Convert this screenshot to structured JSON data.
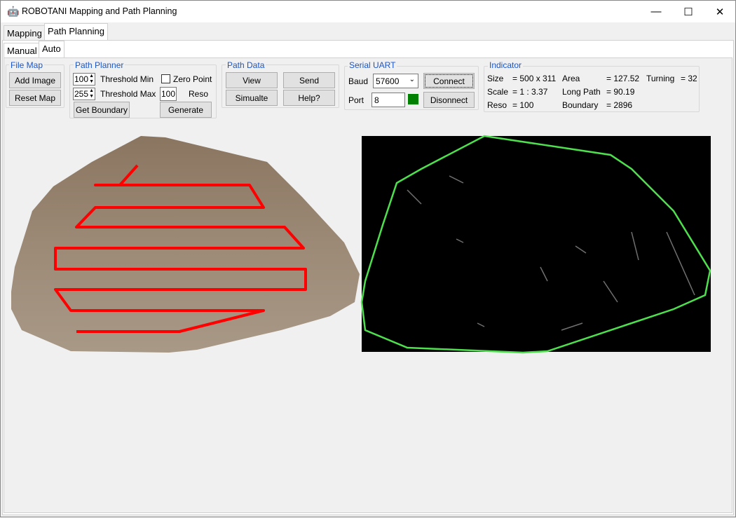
{
  "window": {
    "title": "ROBOTANI Mapping and Path Planning",
    "app_icon": "robot-logo-icon",
    "controls": [
      "minimize",
      "maximize",
      "close"
    ]
  },
  "tabs": [
    {
      "label": "Mapping"
    },
    {
      "label": "Path Planning",
      "active": true
    }
  ],
  "subtabs": [
    {
      "label": "Manual"
    },
    {
      "label": "Auto",
      "active": true
    }
  ],
  "file_map": {
    "title": "File Map",
    "add_image": "Add Image",
    "reset_map": "Reset Map"
  },
  "path_planner": {
    "title": "Path Planner",
    "threshold_min_value": "100",
    "threshold_min_label": "Threshold Min",
    "threshold_max_value": "255",
    "threshold_max_label": "Threshold Max",
    "zero_point_label": "Zero Point",
    "zero_point_checked": false,
    "reso_value": "100",
    "reso_label": "Reso",
    "get_boundary": "Get Boundary",
    "generate": "Generate"
  },
  "path_data": {
    "title": "Path Data",
    "view": "View",
    "send": "Send",
    "simulate": "Simualte",
    "help": "Help?"
  },
  "serial": {
    "title": "Serial UART",
    "baud_label": "Baud",
    "baud_value": "57600",
    "port_label": "Port",
    "port_value": "8",
    "status_color": "#008000",
    "connect": "Connect",
    "disconnect": "Disonnect"
  },
  "indicator": {
    "title": "Indicator",
    "size_label": "Size",
    "size_value": "= 500 x 311",
    "scale_label": "Scale",
    "scale_value": "= 1 : 3.37",
    "reso_label": "Reso",
    "reso_value": "= 100",
    "area_label": "Area",
    "area_value": "= 127.52",
    "long_path_label": "Long Path",
    "long_path_value": "= 90.19",
    "boundary_label": "Boundary",
    "boundary_value": "= 2896",
    "turning_label": "Turning",
    "turning_value": "= 32"
  },
  "colors": {
    "path": "#ff0000",
    "boundary": "#4ee04e",
    "accent": "#1a56c8"
  }
}
